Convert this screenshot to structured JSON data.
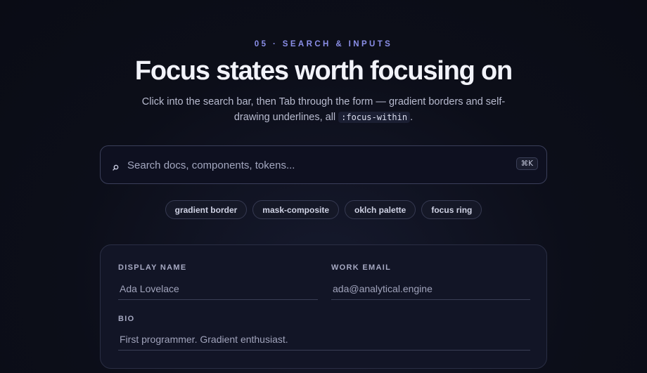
{
  "header": {
    "eyebrow": "05 · SEARCH & INPUTS",
    "title": "Focus states worth focusing on",
    "subtitle_pre": "Click into the search bar, then Tab through the form — gradient borders and self-drawing underlines, all",
    "subtitle_code": ":focus-within",
    "subtitle_post": "."
  },
  "search": {
    "icon": "search-icon",
    "placeholder": "Search docs, components, tokens...",
    "value": "",
    "shortcut": "⌘K"
  },
  "chips": [
    {
      "label": "gradient border"
    },
    {
      "label": "mask-composite"
    },
    {
      "label": "oklch palette"
    },
    {
      "label": "focus ring"
    }
  ],
  "form": {
    "display_name": {
      "label": "DISPLAY NAME",
      "placeholder": "Ada Lovelace"
    },
    "work_email": {
      "label": "WORK EMAIL",
      "placeholder": "ada@analytical.engine"
    },
    "bio": {
      "label": "BIO",
      "placeholder": "First programmer. Gradient enthusiast."
    }
  },
  "colors": {
    "accent": "#8b8fe8",
    "background": "#0b0d17",
    "card": "#121526"
  }
}
